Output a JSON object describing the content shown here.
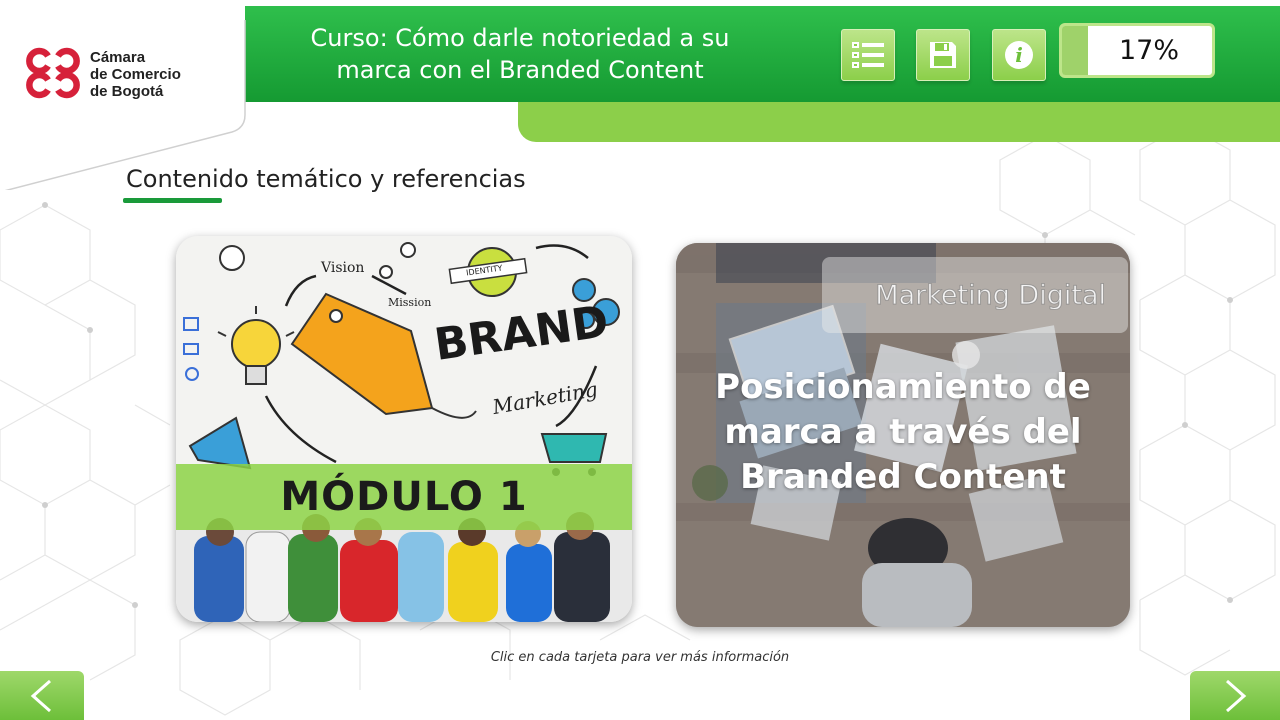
{
  "brand": {
    "logo_text": "Cámara\nde Comercio\nde Bogotá",
    "logo_color": "#d6213a"
  },
  "header": {
    "course_title": "Curso: Cómo darle notoriedad a su marca con el Branded Content",
    "buttons": [
      {
        "icon": "menu-list-icon"
      },
      {
        "icon": "save-icon"
      },
      {
        "icon": "info-icon"
      }
    ],
    "progress": {
      "label": "17%",
      "value": 0.17
    },
    "colors": {
      "primary": "#1fa83d",
      "accent": "#8ccf4a"
    }
  },
  "section": {
    "title": "Contenido temático y referencias"
  },
  "cards": [
    {
      "band_label": "MÓDULO 1",
      "art_words": {
        "brand": "BRAND",
        "marketing": "Marketing",
        "vision": "Vision",
        "mission": "Mission",
        "identity": "IDENTITY"
      }
    },
    {
      "badge": "Marketing Digital",
      "title": "Posicionamiento de marca a través del Branded Content"
    }
  ],
  "footer": {
    "hint": "Clic en cada tarjeta para ver más información"
  },
  "nav": {
    "prev_icon": "chevron-left-icon",
    "next_icon": "chevron-right-icon"
  }
}
